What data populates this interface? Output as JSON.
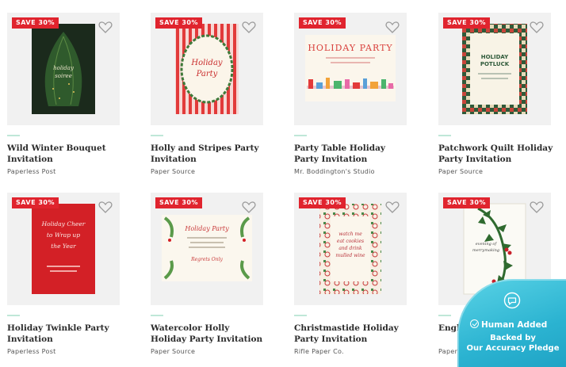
{
  "products": [
    {
      "badge": "SAVE 30%",
      "title": "Wild Winter Bouquet Invitation",
      "brand": "Paperless Post",
      "art_text": [
        "holiday",
        "soiree"
      ]
    },
    {
      "badge": "SAVE 30%",
      "title": "Holly and Stripes Party Invitation",
      "brand": "Paper Source",
      "art_text": [
        "Holiday",
        "Party"
      ]
    },
    {
      "badge": "SAVE 30%",
      "title": "Party Table Holiday Party Invitation",
      "brand": "Mr. Boddington's Studio",
      "art_text": [
        "HOLIDAY PARTY"
      ]
    },
    {
      "badge": "SAVE 30%",
      "title": "Patchwork Quilt Holiday Party Invitation",
      "brand": "Paper Source",
      "art_text": [
        "HOLIDAY",
        "POTLUCK"
      ]
    },
    {
      "badge": "SAVE 30%",
      "title": "Holiday Twinkle Party Invitation",
      "brand": "Paperless Post",
      "art_text": [
        "Holiday Cheer",
        "to Wrap up",
        "the Year"
      ]
    },
    {
      "badge": "SAVE 30%",
      "title": "Watercolor Holly Holiday Party Invitation",
      "brand": "Paper Source",
      "art_text": [
        "Holiday Party",
        "Regrets Only"
      ]
    },
    {
      "badge": "SAVE 30%",
      "title": "Christmastide Holiday Party Invitation",
      "brand": "Rifle Paper Co.",
      "art_text": [
        "watch me",
        "eat cookies",
        "and drink",
        "mulled wine"
      ]
    },
    {
      "badge": "SAVE 30%",
      "title": "English",
      "brand": "Paperless Post",
      "art_text": [
        "evening of",
        "merrymaking"
      ]
    }
  ],
  "pledge": {
    "headline": "Human Added",
    "line1": "Backed by",
    "line2": "Our Accuracy Pledge"
  },
  "colors": {
    "badge_red": "#e0242e",
    "separator_mint": "#bfe7d8",
    "pledge_teal": "#2bb3d1"
  },
  "icons": [
    "heart-icon",
    "chat-bubble-icon",
    "check-circle-icon"
  ]
}
